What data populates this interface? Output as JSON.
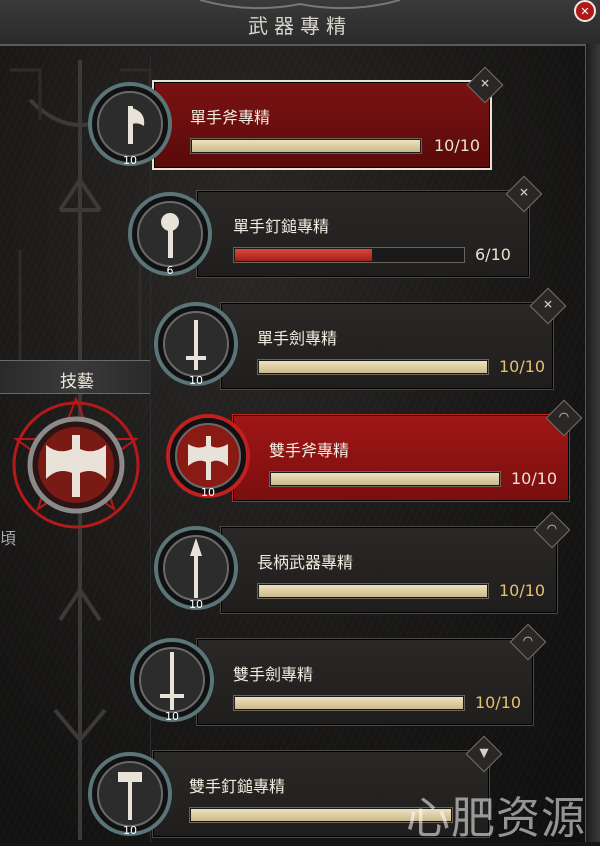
{
  "window": {
    "title": "武器專精",
    "close_icon": "close-icon"
  },
  "sidebar": {
    "tag_label": "技藝",
    "side_char": "頃"
  },
  "skills": [
    {
      "name": "單手斧專精",
      "rank": "10",
      "progress": "10/10",
      "fill": 1.0,
      "state": "selected",
      "icon": "axe-icon",
      "corner_icon": "cross-icon"
    },
    {
      "name": "單手釘鎚專精",
      "rank": "6",
      "progress": "6/10",
      "fill": 0.6,
      "state": "normal",
      "icon": "mace-icon",
      "corner_icon": "cross-icon"
    },
    {
      "name": "單手劍專精",
      "rank": "10",
      "progress": "10/10",
      "fill": 1.0,
      "state": "normal",
      "icon": "sword-icon",
      "corner_icon": "cross-icon"
    },
    {
      "name": "雙手斧專精",
      "rank": "10",
      "progress": "10/10",
      "fill": 1.0,
      "state": "active",
      "icon": "two-handed-axe-icon",
      "corner_icon": "signal-icon"
    },
    {
      "name": "長柄武器專精",
      "rank": "10",
      "progress": "10/10",
      "fill": 1.0,
      "state": "normal",
      "icon": "polearm-icon",
      "corner_icon": "signal-icon"
    },
    {
      "name": "雙手劍專精",
      "rank": "10",
      "progress": "10/10",
      "fill": 1.0,
      "state": "normal",
      "icon": "greatsword-icon",
      "corner_icon": "signal-icon"
    },
    {
      "name": "雙手釘鎚專精",
      "rank": "10",
      "progress": "",
      "fill": 1.0,
      "state": "normal",
      "icon": "hammer-icon",
      "corner_icon": "funnel-icon"
    }
  ],
  "watermark": "心肥资源",
  "colors": {
    "selected_card": "#7a1212",
    "active_card": "#a01616",
    "bar_fill": "#e3d3a8",
    "bar_fill_low": "#c0302a",
    "progress_gold": "#e6c170"
  }
}
